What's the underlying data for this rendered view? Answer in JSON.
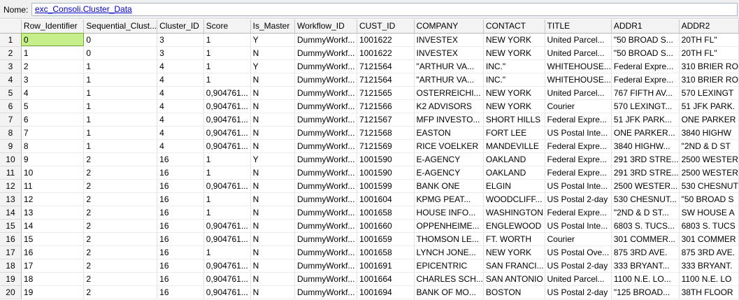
{
  "namebar": {
    "label": "Nome:",
    "value": "exc_Consoli.Cluster_Data"
  },
  "colors": {
    "selected_cell": "#c6ef8c",
    "header_bg": "#f3f3f3",
    "link": "#0000cc"
  },
  "columns": [
    "Row_Identifier",
    "Sequential_Clust...",
    "Cluster_ID",
    "Score",
    "Is_Master",
    "Workflow_ID",
    "CUST_ID",
    "COMPANY",
    "CONTACT",
    "TITLE",
    "ADDR1",
    "ADDR2"
  ],
  "rows": [
    {
      "n": "1",
      "c": [
        "0",
        "0",
        "3",
        "1",
        "Y",
        "DummyWorkf...",
        "1001622",
        "INVESTEX",
        "NEW YORK",
        "United Parcel...",
        "\"50 BROAD S...",
        "20TH FL\""
      ]
    },
    {
      "n": "2",
      "c": [
        "1",
        "0",
        "3",
        "1",
        "N",
        "DummyWorkf...",
        "1001622",
        "INVESTEX",
        "NEW YORK",
        "United Parcel...",
        "\"50 BROAD S...",
        "20TH FL\""
      ]
    },
    {
      "n": "3",
      "c": [
        "2",
        "1",
        "4",
        "1",
        "Y",
        "DummyWorkf...",
        "7121564",
        "\"ARTHUR VA...",
        "INC.\"",
        "WHITEHOUSE...",
        "Federal Expre...",
        "310 BRIER RO"
      ]
    },
    {
      "n": "4",
      "c": [
        "3",
        "1",
        "4",
        "1",
        "N",
        "DummyWorkf...",
        "7121564",
        "\"ARTHUR VA...",
        "INC.\"",
        "WHITEHOUSE...",
        "Federal Expre...",
        "310 BRIER RO"
      ]
    },
    {
      "n": "5",
      "c": [
        "4",
        "1",
        "4",
        "0,904761...",
        "N",
        "DummyWorkf...",
        "7121565",
        "OSTERREICHI...",
        "NEW YORK",
        "United Parcel...",
        "767 FIFTH AV...",
        "570 LEXINGT"
      ]
    },
    {
      "n": "6",
      "c": [
        "5",
        "1",
        "4",
        "0,904761...",
        "N",
        "DummyWorkf...",
        "7121566",
        "K2 ADVISORS",
        "NEW YORK",
        "Courier",
        "570 LEXINGT...",
        "51 JFK PARK."
      ]
    },
    {
      "n": "7",
      "c": [
        "6",
        "1",
        "4",
        "0,904761...",
        "N",
        "DummyWorkf...",
        "7121567",
        "MFP INVESTO...",
        "SHORT HILLS",
        "Federal Expre...",
        "51 JFK PARK...",
        "ONE PARKER"
      ]
    },
    {
      "n": "8",
      "c": [
        "7",
        "1",
        "4",
        "0,904761...",
        "N",
        "DummyWorkf...",
        "7121568",
        "EASTON",
        "FORT LEE",
        "US Postal Inte...",
        "ONE PARKER...",
        "3840 HIGHW"
      ]
    },
    {
      "n": "9",
      "c": [
        "8",
        "1",
        "4",
        "0,904761...",
        "N",
        "DummyWorkf...",
        "7121569",
        "RICE VOELKER",
        "MANDEVILLE",
        "Federal Expre...",
        "3840 HIGHW...",
        "\"2ND & D ST"
      ]
    },
    {
      "n": "10",
      "c": [
        "9",
        "2",
        "16",
        "1",
        "Y",
        "DummyWorkf...",
        "1001590",
        "E-AGENCY",
        "OAKLAND",
        "Federal Expre...",
        "291 3RD STRE...",
        "2500 WESTER"
      ]
    },
    {
      "n": "11",
      "c": [
        "10",
        "2",
        "16",
        "1",
        "N",
        "DummyWorkf...",
        "1001590",
        "E-AGENCY",
        "OAKLAND",
        "Federal Expre...",
        "291 3RD STRE...",
        "2500 WESTER"
      ]
    },
    {
      "n": "12",
      "c": [
        "11",
        "2",
        "16",
        "0,904761...",
        "N",
        "DummyWorkf...",
        "1001599",
        "BANK ONE",
        "ELGIN",
        "US Postal Inte...",
        "2500 WESTER...",
        "530 CHESNUT"
      ]
    },
    {
      "n": "13",
      "c": [
        "12",
        "2",
        "16",
        "1",
        "N",
        "DummyWorkf...",
        "1001604",
        "KPMG PEAT...",
        "WOODCLIFF...",
        "US Postal 2-day",
        "530 CHESNUT...",
        "\"50 BROAD S"
      ]
    },
    {
      "n": "14",
      "c": [
        "13",
        "2",
        "16",
        "1",
        "N",
        "DummyWorkf...",
        "1001658",
        "HOUSE INFO...",
        "WASHINGTON",
        "Federal Expre...",
        "\"2ND & D ST...",
        "SW  HOUSE A"
      ]
    },
    {
      "n": "15",
      "c": [
        "14",
        "2",
        "16",
        "0,904761...",
        "N",
        "DummyWorkf...",
        "1001660",
        "OPPENHEIME...",
        "ENGLEWOOD",
        "US Postal Inte...",
        "6803 S. TUCS...",
        "6803 S. TUCS"
      ]
    },
    {
      "n": "16",
      "c": [
        "15",
        "2",
        "16",
        "0,904761...",
        "N",
        "DummyWorkf...",
        "1001659",
        "THOMSON LE...",
        "FT. WORTH",
        "Courier",
        "301 COMMER...",
        "301 COMMER"
      ]
    },
    {
      "n": "17",
      "c": [
        "16",
        "2",
        "16",
        "1",
        "N",
        "DummyWorkf...",
        "1001658",
        "LYNCH JONE...",
        "NEW YORK",
        "US Postal Ove...",
        "875 3RD AVE.",
        "875 3RD AVE."
      ]
    },
    {
      "n": "18",
      "c": [
        "17",
        "2",
        "16",
        "0,904761...",
        "N",
        "DummyWorkf...",
        "1001691",
        "EPICENTRIC",
        "SAN FRANCI...",
        "US Postal 2-day",
        "333 BRYANT...",
        "333 BRYANT."
      ]
    },
    {
      "n": "19",
      "c": [
        "18",
        "2",
        "16",
        "0,904761...",
        "N",
        "DummyWorkf...",
        "1001664",
        "CHARLES SCH...",
        "SAN ANTONIO",
        "United Parcel...",
        "1100 N.E. LO...",
        "1100 N.E. LO"
      ]
    },
    {
      "n": "20",
      "c": [
        "19",
        "2",
        "16",
        "0,904761...",
        "N",
        "DummyWorkf...",
        "1001694",
        "BANK OF MO...",
        "BOSTON",
        "US Postal 2-day",
        "\"125 BROAD...",
        "38TH FLOOR"
      ]
    }
  ]
}
